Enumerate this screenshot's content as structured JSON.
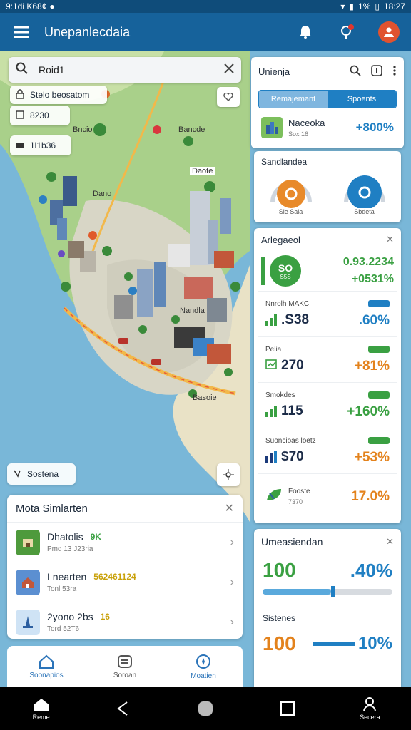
{
  "statusbar": {
    "time": "9:1di K68¢",
    "battery": "1%",
    "clock": "18:27"
  },
  "appbar": {
    "title": "Unepanlecdaia"
  },
  "map": {
    "search_value": "Roid1",
    "chip1": "Stelo beosatom",
    "chip2": "8230",
    "chip3": "1l1b36",
    "labels": [
      "Bncio",
      "Bancde",
      "Dano",
      "Daote",
      "Nandla",
      "Basoie"
    ],
    "station_label": "Sostena"
  },
  "sim_panel": {
    "title": "Mota Simlarten",
    "items": [
      {
        "name": "Dhatolis",
        "badge": "9K",
        "sub": "Pmd 13 J23ria"
      },
      {
        "name": "Lnearten",
        "badge": "562461124",
        "sub": "Tonl 53ra"
      },
      {
        "name": "2yono 2bs",
        "badge": "16",
        "sub": "Tord 52T6"
      }
    ]
  },
  "bottom_tabs": [
    {
      "label": "Soonapios"
    },
    {
      "label": "Soroan"
    },
    {
      "label": "Moatien"
    }
  ],
  "right": {
    "top_title": "Unienja",
    "tab1": "Remajemant",
    "tab2": "Spoents",
    "featured": {
      "name": "Naceoka",
      "sub": "Sox 16",
      "pct": "+800%"
    },
    "sandiandea": {
      "title": "Sandlandea",
      "g1": "Sie Sala",
      "g2": "Sbdeta"
    },
    "arleg": {
      "title": "Arlegaeol",
      "hero_val": "SO",
      "hero_sub": "S5S",
      "hero_pct1": "0.93.2234",
      "hero_pct2": "+0531%"
    },
    "stats": [
      {
        "label": "Nnrolh MAKC",
        "value": ".S38",
        "pct": ".60%",
        "pill": "",
        "color": "#1f7fc3"
      },
      {
        "label": "Pelia",
        "value": "270",
        "pct": "+81%",
        "pill": "",
        "color": "#e3821c"
      },
      {
        "label": "Smokdes",
        "value": "115",
        "pct": "+160%",
        "pill": "",
        "color": "#3aa042"
      },
      {
        "label": "Suoncioas loetz",
        "value": "$70",
        "pct": "+53%",
        "pill": "",
        "color": "#e3821c"
      }
    ],
    "footer_stat": {
      "label": "Fooste",
      "sub": "7370",
      "pct": "17.0%"
    },
    "umeasiendan": {
      "title": "Umeasiendan",
      "big": "100",
      "pct": ".40%"
    },
    "sistenes": {
      "title": "Sistenes",
      "big": "100",
      "pct": "10%"
    }
  },
  "navbar": {
    "home": "Reme",
    "recent": "Secera"
  }
}
